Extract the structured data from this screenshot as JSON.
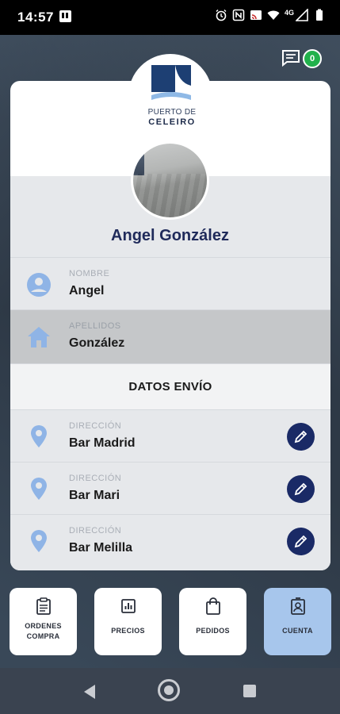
{
  "status_bar": {
    "time": "14:57",
    "network": "4G"
  },
  "header": {
    "chat_count": "0"
  },
  "logo": {
    "line1": "PUERTO DE",
    "line2": "CELEIRO"
  },
  "profile": {
    "name": "Angel González"
  },
  "fields": [
    {
      "label": "NOMBRE",
      "value": "Angel",
      "icon": "person-icon"
    },
    {
      "label": "APELLIDOS",
      "value": "González",
      "icon": "home-icon"
    }
  ],
  "shipping": {
    "title": "DATOS ENVÍO",
    "addresses": [
      {
        "label": "DIRECCIÓN",
        "value": "Bar Madrid"
      },
      {
        "label": "DIRECCIÓN",
        "value": "Bar Mari"
      },
      {
        "label": "DIRECCIÓN",
        "value": "Bar Melilla"
      }
    ]
  },
  "bottom_nav": [
    {
      "label_line1": "ORDENES",
      "label_line2": "COMPRA",
      "icon": "clipboard-icon",
      "active": false
    },
    {
      "label_line1": "PRECIOS",
      "label_line2": "",
      "icon": "chart-icon",
      "active": false
    },
    {
      "label_line1": "PEDIDOS",
      "label_line2": "",
      "icon": "bag-icon",
      "active": false
    },
    {
      "label_line1": "CUENTA",
      "label_line2": "",
      "icon": "id-badge-icon",
      "active": true
    }
  ],
  "colors": {
    "accent_navy": "#1a2a66",
    "active_tab": "#a7c6ec",
    "icon_blue": "#8fb4e6",
    "badge_green": "#22b14c"
  }
}
